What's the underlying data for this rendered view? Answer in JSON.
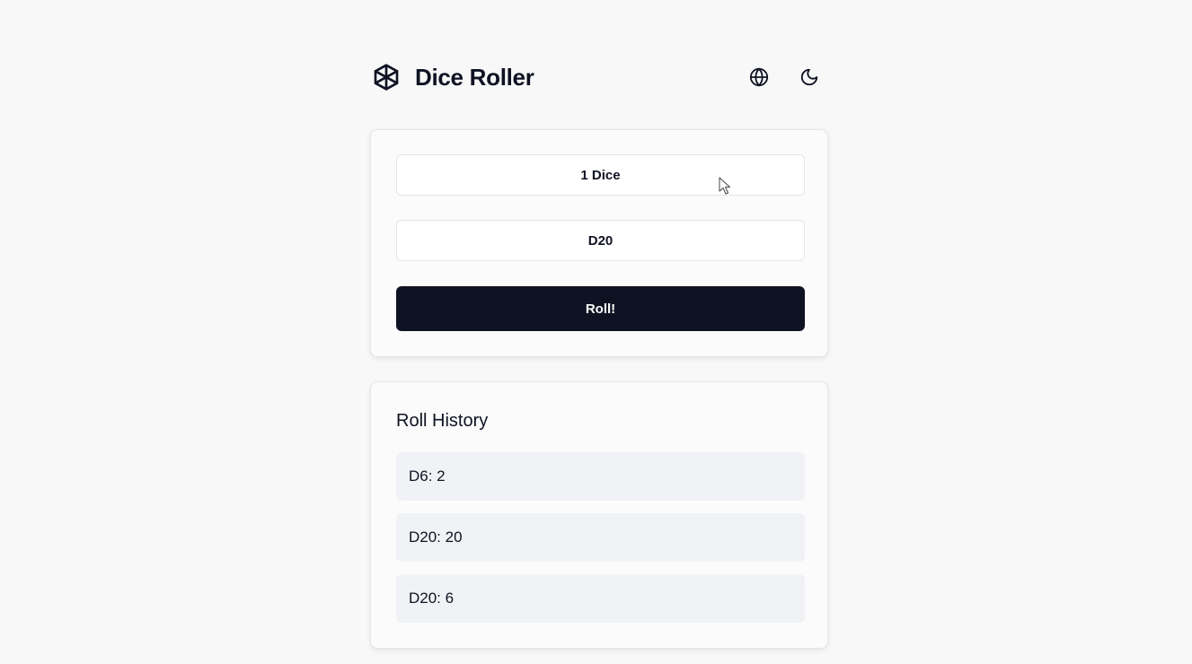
{
  "header": {
    "title": "Dice Roller",
    "logo_icon": "dice-cube-icon",
    "language_icon": "globe-icon",
    "theme_icon": "moon-icon"
  },
  "controls": {
    "dice_count_label": "1 Dice",
    "die_type_label": "D20",
    "roll_label": "Roll!"
  },
  "history": {
    "title": "Roll History",
    "items": [
      {
        "label": "D6: 2"
      },
      {
        "label": "D20: 20"
      },
      {
        "label": "D20: 6"
      }
    ]
  },
  "colors": {
    "primary": "#0f1222",
    "background": "#f8f8f8",
    "card": "#fbfbfb",
    "history_item": "#f1f2f5",
    "border": "#e4e5ea"
  }
}
